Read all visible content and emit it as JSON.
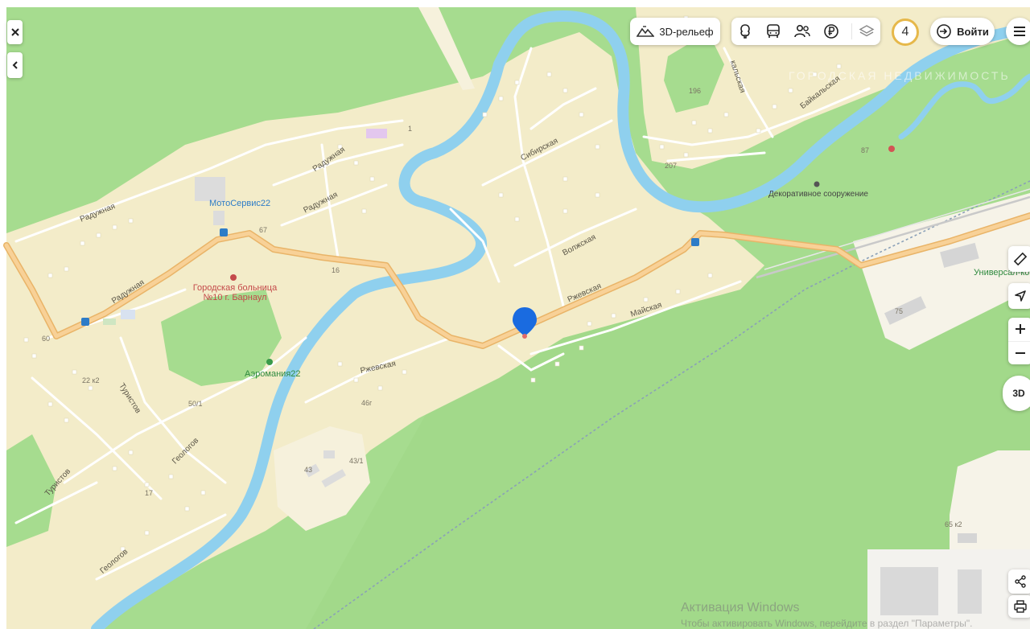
{
  "toolbar": {
    "relief_label": "3D-рельеф",
    "counter": "4",
    "login_label": "Войти",
    "view3d_label": "3D"
  },
  "streets": {
    "raduzhnaya": "Радужная",
    "sibirskaya": "Сибирская",
    "volzhskaya": "Волжская",
    "rzhevskaya": "Ржевская",
    "mayskaya": "Майская",
    "turistov": "Туристов",
    "geologov": "Геологов",
    "baykalskaya": "Байкальская",
    "kalskaya": "кальская"
  },
  "pois": {
    "motoservis": "МотоСервис22",
    "hospital": "Городская больница №10 г. Барнаул",
    "aeromania": "Аэромания22",
    "decorative": "Декоративное сооружение",
    "universal": "Универсал-ком"
  },
  "house_numbers": {
    "n1": "1",
    "n67": "67",
    "n16": "16",
    "n60": "60",
    "n22k2": "22 к2",
    "n50_1": "50/1",
    "n17": "17",
    "n46g": "46г",
    "n43": "43",
    "n43_1": "43/1",
    "n196": "196",
    "n207": "207",
    "n87": "87",
    "n75": "75",
    "n65k2": "65 к2"
  },
  "watermarks": {
    "brand": "ГОРОДСКАЯ НЕДВИЖИМОСТЬ",
    "activation_title": "Активация Windows",
    "activation_sub": "Чтобы активировать Windows, перейдите в раздел \"Параметры\"."
  },
  "colors": {
    "forest": "#9fd98a",
    "settlement": "#f3ecc9",
    "river": "#8fd0ee",
    "main_road": "#f5c77e",
    "pin": "#1a6be0"
  }
}
